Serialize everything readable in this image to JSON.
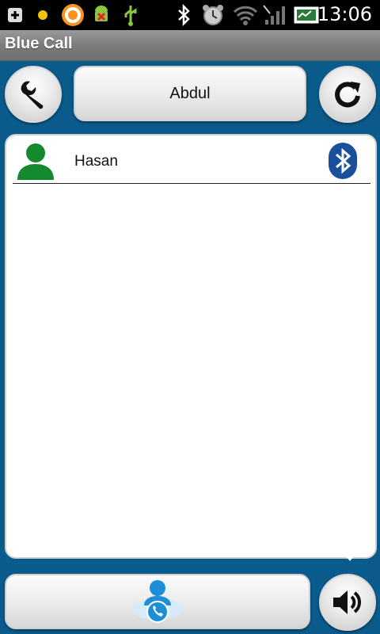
{
  "status_bar": {
    "time": "13:06",
    "icons": [
      "add-icon",
      "notification-dot-icon",
      "app-circle-icon",
      "android-debug-icon",
      "usb-icon",
      "bluetooth-icon",
      "alarm-icon",
      "wifi-icon",
      "signal-icon",
      "battery-icon"
    ]
  },
  "app": {
    "title": "Blue Call"
  },
  "toolbar": {
    "settings_icon": "wrench-icon",
    "selected_contact": "Abdul",
    "refresh_icon": "refresh-icon"
  },
  "contacts": [
    {
      "name": "Hasan",
      "avatar_icon": "person-icon",
      "status_icon": "bluetooth-icon"
    }
  ],
  "bottom": {
    "call_icon": "call-contact-icon",
    "speaker_icon": "speaker-icon"
  },
  "colors": {
    "background": "#0a5a8c",
    "bluetooth_blue": "#1a4f9c",
    "avatar_green": "#138a2e",
    "call_blue": "#1e8fd6"
  }
}
